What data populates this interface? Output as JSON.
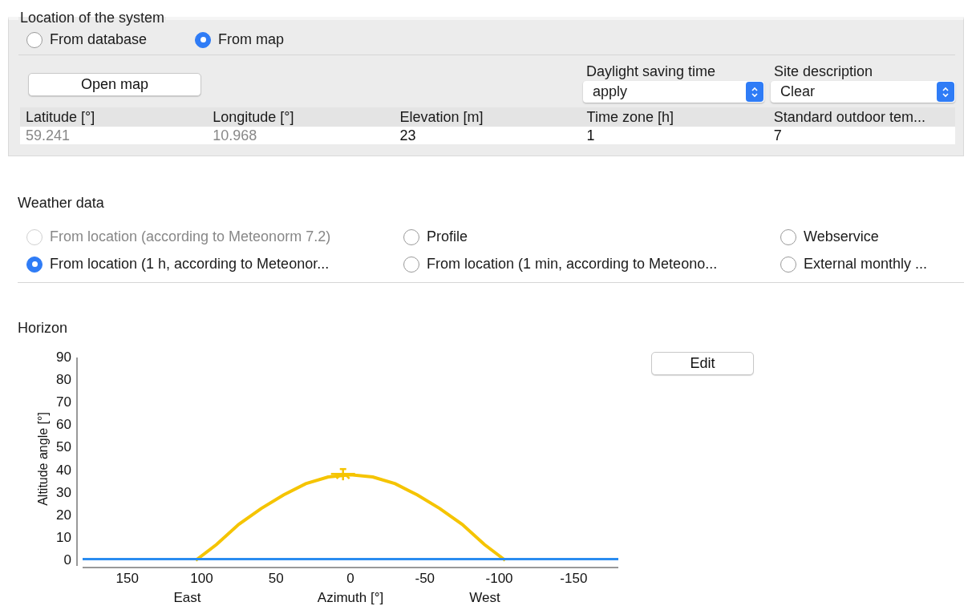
{
  "location": {
    "title": "Location of the system",
    "source_options": [
      {
        "label": "From database",
        "selected": false
      },
      {
        "label": "From map",
        "selected": true
      }
    ],
    "open_map_button": "Open map",
    "dropdowns": [
      {
        "label": "Daylight saving time",
        "value": "apply"
      },
      {
        "label": "Site description",
        "value": "Clear"
      }
    ],
    "table": {
      "columns": [
        "Latitude [°]",
        "Longitude [°]",
        "Elevation [m]",
        "Time zone [h]",
        "Standard outdoor tem..."
      ],
      "row": [
        {
          "value": "59.241",
          "disabled": true
        },
        {
          "value": "10.968",
          "disabled": true
        },
        {
          "value": "23",
          "disabled": false
        },
        {
          "value": "1",
          "disabled": false
        },
        {
          "value": "7",
          "disabled": false
        }
      ]
    }
  },
  "weather": {
    "title": "Weather data",
    "options": [
      {
        "label": "From location (according to Meteonorm 7.2)",
        "selected": false,
        "disabled": true
      },
      {
        "label": "Profile",
        "selected": false,
        "disabled": false
      },
      {
        "label": "Webservice",
        "selected": false,
        "disabled": false
      },
      {
        "label": "From location (1 h, according to Meteonor...",
        "selected": true,
        "disabled": false
      },
      {
        "label": "From location (1 min, according to Meteono...",
        "selected": false,
        "disabled": false
      },
      {
        "label": "External monthly ...",
        "selected": false,
        "disabled": false
      }
    ]
  },
  "horizon": {
    "title": "Horizon",
    "edit_button": "Edit",
    "chart_data": {
      "type": "line",
      "xlabel": "Azimuth [°]",
      "ylabel": "Altitude angle [°]",
      "xlim": [
        180,
        -180
      ],
      "ylim": [
        0,
        90
      ],
      "xticks": [
        150,
        100,
        50,
        0,
        -50,
        -100,
        -150
      ],
      "yticks": [
        0,
        10,
        20,
        30,
        40,
        50,
        60,
        70,
        80,
        90
      ],
      "series": [
        {
          "color": "#f5c400",
          "x": [
            104,
            90,
            75,
            60,
            45,
            30,
            15,
            0,
            -15,
            -30,
            -45,
            -60,
            -75,
            -90,
            -104
          ],
          "values": [
            0,
            7,
            16,
            23,
            29,
            34,
            37,
            38,
            37,
            34,
            29,
            23,
            16,
            7,
            0
          ]
        },
        {
          "color": "#2a8cf0",
          "x": [
            180,
            -180
          ],
          "values": [
            0.5,
            0.5
          ]
        }
      ],
      "annotations": [
        "East",
        "West"
      ]
    }
  }
}
